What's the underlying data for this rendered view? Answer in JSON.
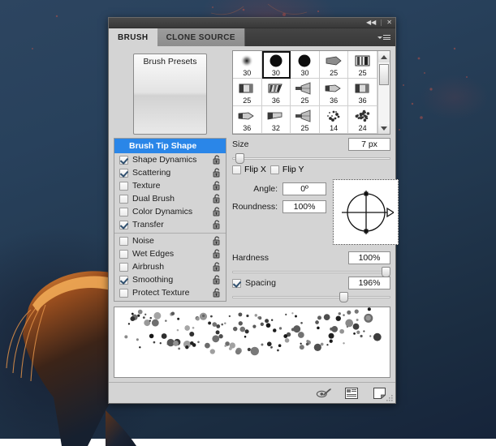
{
  "titlebar": {
    "collapse_label": "◀◀",
    "close_label": "✕"
  },
  "tabs": [
    {
      "label": "BRUSH",
      "active": true
    },
    {
      "label": "CLONE SOURCE",
      "active": false
    }
  ],
  "toolbar": {
    "brush_presets_label": "Brush Presets"
  },
  "brush_grid": {
    "selected_index": 1,
    "items": [
      {
        "size": "30",
        "tip": "soft-round"
      },
      {
        "size": "30",
        "tip": "hard-round"
      },
      {
        "size": "30",
        "tip": "hard-round"
      },
      {
        "size": "25",
        "tip": "flat-angled"
      },
      {
        "size": "25",
        "tip": "bristle-block"
      },
      {
        "size": "25",
        "tip": "flat-block"
      },
      {
        "size": "36",
        "tip": "bristle-slant"
      },
      {
        "size": "25",
        "tip": "fan"
      },
      {
        "size": "36",
        "tip": "flat-taper"
      },
      {
        "size": "36",
        "tip": "flat-block"
      },
      {
        "size": "36",
        "tip": "flat-taper"
      },
      {
        "size": "32",
        "tip": "flat-slant"
      },
      {
        "size": "25",
        "tip": "fan"
      },
      {
        "size": "14",
        "tip": "spatter"
      },
      {
        "size": "24",
        "tip": "spatter-dense"
      }
    ]
  },
  "sidebar": {
    "header": "Brush Tip Shape",
    "items": [
      {
        "label": "Shape Dynamics",
        "checked": true,
        "locked": false
      },
      {
        "label": "Scattering",
        "checked": true,
        "locked": false
      },
      {
        "label": "Texture",
        "checked": false,
        "locked": false
      },
      {
        "label": "Dual Brush",
        "checked": false,
        "locked": false
      },
      {
        "label": "Color Dynamics",
        "checked": false,
        "locked": false
      },
      {
        "label": "Transfer",
        "checked": true,
        "locked": false
      },
      {
        "label": "Noise",
        "checked": false,
        "locked": false,
        "group_start": true
      },
      {
        "label": "Wet Edges",
        "checked": false,
        "locked": false
      },
      {
        "label": "Airbrush",
        "checked": false,
        "locked": false
      },
      {
        "label": "Smoothing",
        "checked": true,
        "locked": false
      },
      {
        "label": "Protect Texture",
        "checked": false,
        "locked": false
      }
    ]
  },
  "controls": {
    "size": {
      "label": "Size",
      "value": "7 px",
      "slider_pct": 2
    },
    "flip_x": {
      "label": "Flip X",
      "checked": false
    },
    "flip_y": {
      "label": "Flip Y",
      "checked": false
    },
    "angle": {
      "label": "Angle:",
      "value": "0º"
    },
    "roundness": {
      "label": "Roundness:",
      "value": "100%"
    },
    "hardness": {
      "label": "Hardness",
      "value": "100%",
      "slider_pct": 100
    },
    "spacing": {
      "label": "Spacing",
      "value": "196%",
      "checked": true,
      "slider_pct": 72
    }
  },
  "footer": {
    "icons": [
      {
        "name": "toggle-live-tip-brush-icon"
      },
      {
        "name": "open-preset-manager-icon"
      },
      {
        "name": "create-new-brush-icon"
      }
    ]
  },
  "colors": {
    "accent": "#2a86e8",
    "panel_bg": "#d4d4d4",
    "titlebar": "#3c3c3c",
    "tab_active_bg": "#d4d4d4",
    "tab_inactive_bg": "#949494",
    "desktop_blue": "#26405a",
    "rim_orange": "#c86a28"
  }
}
